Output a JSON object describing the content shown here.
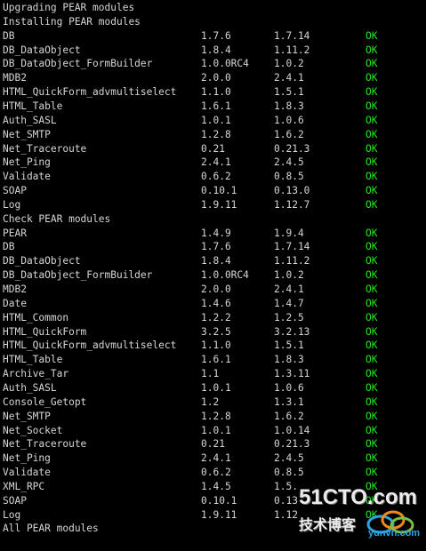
{
  "colors": {
    "background": "#000000",
    "text": "#d6d6d6",
    "ok": "#22e822"
  },
  "header_lines": [
    "Upgrading PEAR modules",
    "Installing PEAR modules"
  ],
  "install_rows": [
    {
      "name": "DB",
      "required": "1.7.6",
      "installed": "1.7.14",
      "status": "OK"
    },
    {
      "name": "DB_DataObject",
      "required": "1.8.4",
      "installed": "1.11.2",
      "status": "OK"
    },
    {
      "name": "DB_DataObject_FormBuilder",
      "required": "1.0.0RC4",
      "installed": "1.0.2",
      "status": "OK"
    },
    {
      "name": "MDB2",
      "required": "2.0.0",
      "installed": "2.4.1",
      "status": "OK"
    },
    {
      "name": "HTML_QuickForm_advmultiselect",
      "required": "1.1.0",
      "installed": "1.5.1",
      "status": "OK"
    },
    {
      "name": "HTML_Table",
      "required": "1.6.1",
      "installed": "1.8.3",
      "status": "OK"
    },
    {
      "name": "Auth_SASL",
      "required": "1.0.1",
      "installed": "1.0.6",
      "status": "OK"
    },
    {
      "name": "Net_SMTP",
      "required": "1.2.8",
      "installed": "1.6.2",
      "status": "OK"
    },
    {
      "name": "Net_Traceroute",
      "required": "0.21",
      "installed": "0.21.3",
      "status": "OK"
    },
    {
      "name": "Net_Ping",
      "required": "2.4.1",
      "installed": "2.4.5",
      "status": "OK"
    },
    {
      "name": "Validate",
      "required": "0.6.2",
      "installed": "0.8.5",
      "status": "OK"
    },
    {
      "name": "SOAP",
      "required": "0.10.1",
      "installed": "0.13.0",
      "status": "OK"
    },
    {
      "name": "Log",
      "required": "1.9.11",
      "installed": "1.12.7",
      "status": "OK"
    }
  ],
  "check_header": "Check PEAR modules",
  "check_rows": [
    {
      "name": "PEAR",
      "required": "1.4.9",
      "installed": "1.9.4",
      "status": "OK"
    },
    {
      "name": "DB",
      "required": "1.7.6",
      "installed": "1.7.14",
      "status": "OK"
    },
    {
      "name": "DB_DataObject",
      "required": "1.8.4",
      "installed": "1.11.2",
      "status": "OK"
    },
    {
      "name": "DB_DataObject_FormBuilder",
      "required": "1.0.0RC4",
      "installed": "1.0.2",
      "status": "OK"
    },
    {
      "name": "MDB2",
      "required": "2.0.0",
      "installed": "2.4.1",
      "status": "OK"
    },
    {
      "name": "Date",
      "required": "1.4.6",
      "installed": "1.4.7",
      "status": "OK"
    },
    {
      "name": "HTML_Common",
      "required": "1.2.2",
      "installed": "1.2.5",
      "status": "OK"
    },
    {
      "name": "HTML_QuickForm",
      "required": "3.2.5",
      "installed": "3.2.13",
      "status": "OK"
    },
    {
      "name": "HTML_QuickForm_advmultiselect",
      "required": "1.1.0",
      "installed": "1.5.1",
      "status": "OK"
    },
    {
      "name": "HTML_Table",
      "required": "1.6.1",
      "installed": "1.8.3",
      "status": "OK"
    },
    {
      "name": "Archive_Tar",
      "required": "1.1",
      "installed": "1.3.11",
      "status": "OK"
    },
    {
      "name": "Auth_SASL",
      "required": "1.0.1",
      "installed": "1.0.6",
      "status": "OK"
    },
    {
      "name": "Console_Getopt",
      "required": "1.2",
      "installed": "1.3.1",
      "status": "OK"
    },
    {
      "name": "Net_SMTP",
      "required": "1.2.8",
      "installed": "1.6.2",
      "status": "OK"
    },
    {
      "name": "Net_Socket",
      "required": "1.0.1",
      "installed": "1.0.14",
      "status": "OK"
    },
    {
      "name": "Net_Traceroute",
      "required": "0.21",
      "installed": "0.21.3",
      "status": "OK"
    },
    {
      "name": "Net_Ping",
      "required": "2.4.1",
      "installed": "2.4.5",
      "status": "OK"
    },
    {
      "name": "Validate",
      "required": "0.6.2",
      "installed": "0.8.5",
      "status": "OK"
    },
    {
      "name": "XML_RPC",
      "required": "1.4.5",
      "installed": "1.5.",
      "status": "OK"
    },
    {
      "name": "SOAP",
      "required": "0.10.1",
      "installed": "0.13",
      "status": "OK"
    },
    {
      "name": "Log",
      "required": "1.9.11",
      "installed": "1.12",
      "status": "OK"
    }
  ],
  "footer_line": "All PEAR modules",
  "watermark": {
    "main": "51CTO.com",
    "sub": "技术博客",
    "logo_text": "yunvn.com",
    "logo_icon": "cloud-logo-icon"
  }
}
